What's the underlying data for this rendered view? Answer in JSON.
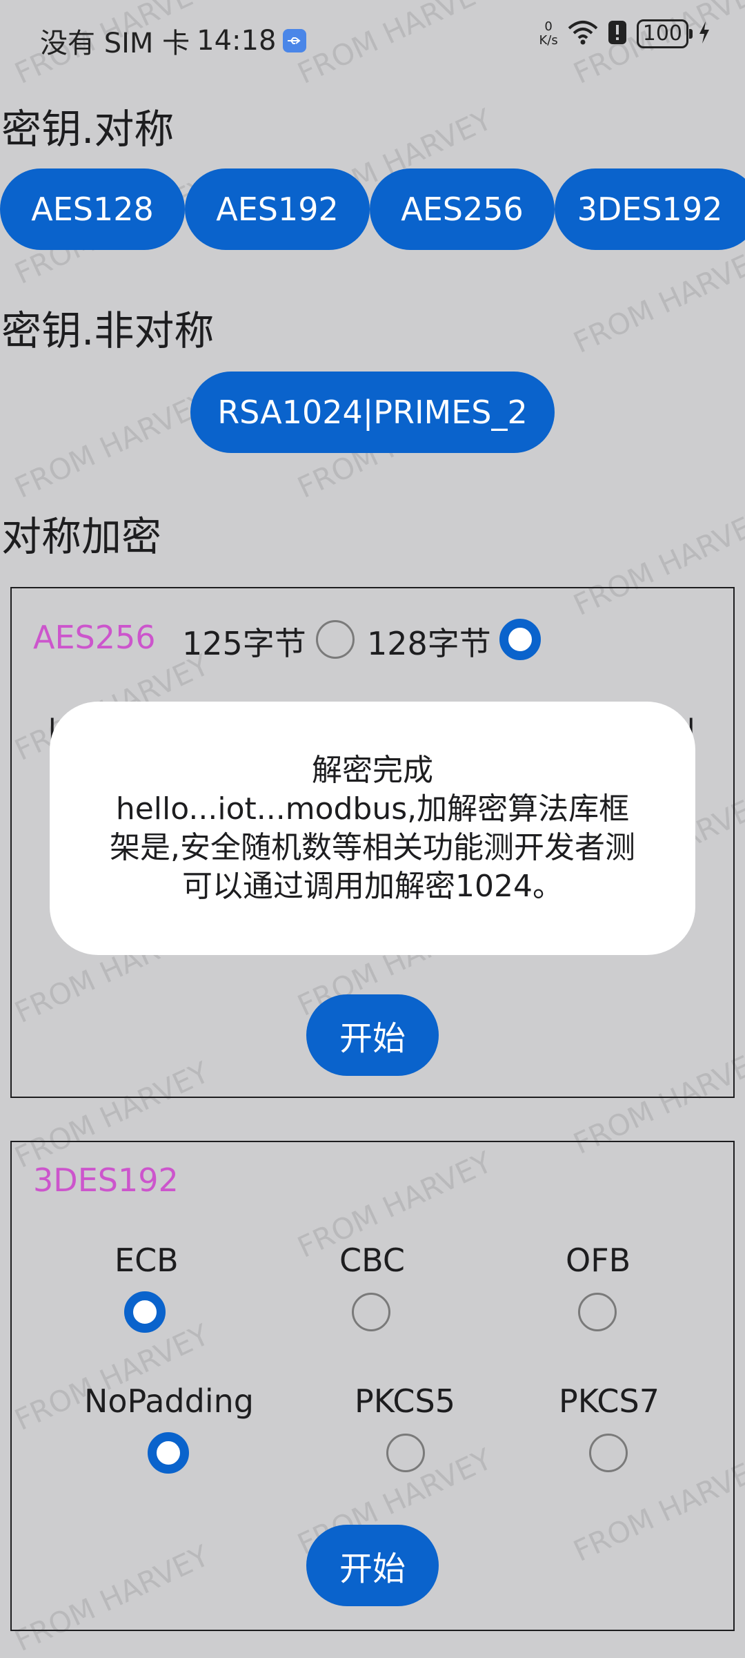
{
  "status_bar": {
    "carrier_text": "没有 SIM 卡",
    "time": "14:18",
    "net_speed_value": "0",
    "net_speed_unit": "K/s",
    "battery": "100"
  },
  "sections": {
    "symmetric_key_title": "密钥.对称",
    "asymmetric_key_title": "密钥.非对称",
    "symmetric_encrypt_title": "对称加密"
  },
  "symmetric_keys": [
    "AES128",
    "AES192",
    "AES256",
    "3DES192"
  ],
  "asymmetric_key": "RSA1024|PRIMES_2",
  "aes_panel": {
    "label": "AES256",
    "option_125": "125字节",
    "option_128": "128字节",
    "selected": "128字节",
    "start_label": "开始"
  },
  "des_panel": {
    "label": "3DES192",
    "modes": [
      "ECB",
      "CBC",
      "OFB"
    ],
    "selected_mode": "ECB",
    "paddings": [
      "NoPadding",
      "PKCS5",
      "PKCS7"
    ],
    "selected_padding": "NoPadding",
    "start_label": "开始"
  },
  "dialog": {
    "message": "解密完成\nhello...iot...modbus,加解密算法库框架是,安全随机数等相关功能测开发者测可以通过调用加解密1024。"
  },
  "watermark": "FROM HARVEY",
  "colors": {
    "background": "#cdcdcf",
    "accent": "#0a63cc",
    "algo_label": "#cc55cc"
  }
}
